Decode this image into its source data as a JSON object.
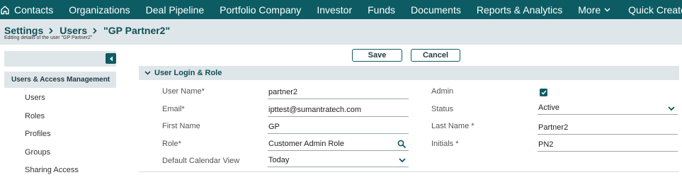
{
  "nav": {
    "items": [
      "Contacts",
      "Organizations",
      "Deal Pipeline",
      "Portfolio Company",
      "Investor",
      "Funds",
      "Documents",
      "Reports & Analytics"
    ],
    "more_label": "More",
    "quick_create_label": "Quick Create"
  },
  "breadcrumb": {
    "settings": "Settings",
    "users": "Users",
    "current": "\"GP Partner2\""
  },
  "page": {
    "subtitle": "Editing details of the user \"GP Partner2\""
  },
  "sidebar": {
    "group_label": "Users & Access Management",
    "items": [
      "Users",
      "Roles",
      "Profiles",
      "Groups",
      "Sharing Access"
    ]
  },
  "actions": {
    "save_label": "Save",
    "cancel_label": "Cancel"
  },
  "section": {
    "title": "User Login & Role",
    "fields": {
      "user_name_label": "User Name*",
      "user_name_value": "partner2",
      "email_label": "Email*",
      "email_value": "ipttest@sumantratech.com",
      "first_name_label": "First Name",
      "first_name_value": "GP",
      "role_label": "Role*",
      "role_value": "Customer Admin Role",
      "calendar_label": "Default Calendar View",
      "calendar_value": "Today",
      "admin_label": "Admin",
      "admin_checked": true,
      "status_label": "Status",
      "status_value": "Active",
      "last_name_label": "Last Name *",
      "last_name_value": "Partner2",
      "initials_label": "Initials *",
      "initials_value": "PN2"
    }
  },
  "colors": {
    "primary": "#0d5c63",
    "header_bg": "#dfe6e9"
  }
}
